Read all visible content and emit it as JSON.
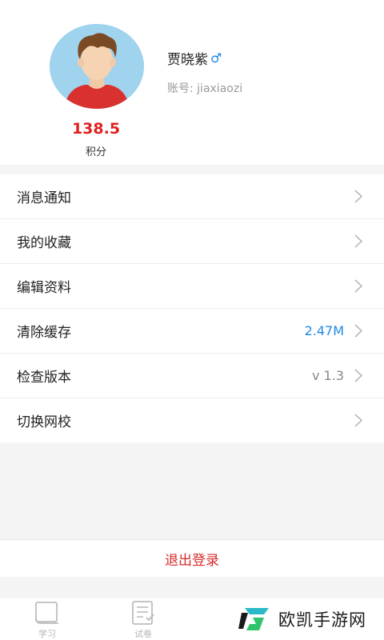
{
  "profile": {
    "name": "贾晓紫",
    "gender_symbol": "♂",
    "account": "账号: jiaxiaozi",
    "score": "138.5",
    "score_label": "积分"
  },
  "menu": [
    {
      "label": "消息通知",
      "value": ""
    },
    {
      "label": "我的收藏",
      "value": ""
    },
    {
      "label": "编辑资料",
      "value": ""
    },
    {
      "label": "清除缓存",
      "value": "2.47M",
      "value_color": "#1e88e5"
    },
    {
      "label": "检查版本",
      "value": "v 1.3",
      "value_color": "#888888"
    },
    {
      "label": "切换网校",
      "value": ""
    }
  ],
  "logout_label": "退出登录",
  "tabs": [
    {
      "label": "学习",
      "icon": "book-icon"
    },
    {
      "label": "试卷",
      "icon": "paper-icon"
    }
  ],
  "watermark": {
    "text": "欧凯手游网",
    "icon": "brand-logo-icon"
  },
  "colors": {
    "accent_red": "#e02020",
    "link_blue": "#1e88e5"
  }
}
